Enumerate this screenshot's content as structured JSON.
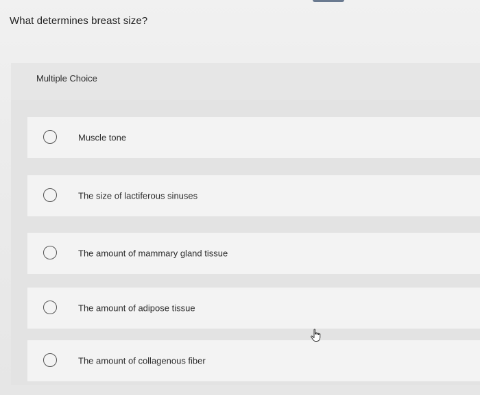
{
  "question": {
    "text": "What determines breast size?"
  },
  "question_type": {
    "label": "Multiple Choice"
  },
  "choices": [
    {
      "label": "Muscle tone",
      "selected": false
    },
    {
      "label": "The size of lactiferous sinuses",
      "selected": false
    },
    {
      "label": "The amount of mammary gland tissue",
      "selected": false
    },
    {
      "label": "The amount of adipose tissue",
      "selected": false
    },
    {
      "label": "The amount of collagenous fiber",
      "selected": false
    }
  ],
  "icons": {
    "radio": "radio-unselected-icon",
    "cursor": "hand-pointer-icon"
  },
  "colors": {
    "background": "#ececec",
    "choice_background": "#f3f3f3",
    "text": "#222222",
    "radio_border": "#555555"
  }
}
